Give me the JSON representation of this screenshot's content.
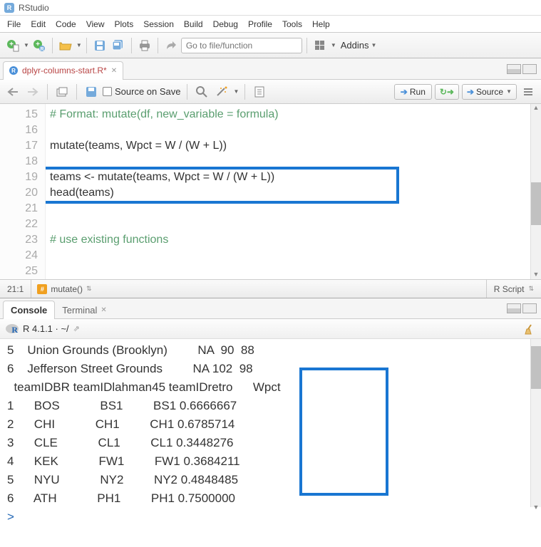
{
  "titlebar": {
    "app_name": "RStudio"
  },
  "menubar": [
    "File",
    "Edit",
    "Code",
    "View",
    "Plots",
    "Session",
    "Build",
    "Debug",
    "Profile",
    "Tools",
    "Help"
  ],
  "toolbar": {
    "goto_placeholder": "Go to file/function",
    "addins_label": "Addins"
  },
  "editor": {
    "tab_name": "dplyr-columns-start.R*",
    "toolbar": {
      "source_on_save": "Source on Save",
      "run": "Run",
      "source": "Source"
    },
    "line_numbers": [
      "15",
      "16",
      "17",
      "18",
      "19",
      "20",
      "21",
      "22",
      "23",
      "24",
      "25"
    ],
    "lines": {
      "l15": "# Format: mutate(df, new_variable = formula)",
      "l16": "",
      "l17": "mutate(teams, Wpct = W / (W + L))",
      "l18": "",
      "l19": "teams <- mutate(teams, Wpct = W / (W + L))",
      "l20": "head(teams)",
      "l21": "",
      "l22": "",
      "l23": "# use existing functions",
      "l24": "",
      "l25": ""
    },
    "status": {
      "cursor": "21:1",
      "scope": "mutate()",
      "lang": "R Script"
    }
  },
  "console": {
    "tabs": {
      "console": "Console",
      "terminal": "Terminal"
    },
    "version": "R 4.1.1 · ~/",
    "output_line1": "5    Union Grounds (Brooklyn)         NA  90  88",
    "output_line2": "6    Jefferson Street Grounds         NA 102  98",
    "output_line3": "  teamIDBR teamIDlahman45 teamIDretro      Wpct",
    "output_line4": "1      BOS            BS1         BS1 0.6666667",
    "output_line5": "2      CHI            CH1         CH1 0.6785714",
    "output_line6": "3      CLE            CL1         CL1 0.3448276",
    "output_line7": "4      KEK            FW1         FW1 0.3684211",
    "output_line8": "5      NYU            NY2         NY2 0.4848485",
    "output_line9": "6      ATH            PH1         PH1 0.7500000",
    "prompt": "> "
  },
  "chart_data": {
    "type": "table",
    "title": "teams (after mutate Wpct = W / (W + L))",
    "columns": [
      "teamIDBR",
      "teamIDlahman45",
      "teamIDretro",
      "Wpct"
    ],
    "rows": [
      {
        "row": 1,
        "teamIDBR": "BOS",
        "teamIDlahman45": "BS1",
        "teamIDretro": "BS1",
        "Wpct": 0.6666667
      },
      {
        "row": 2,
        "teamIDBR": "CHI",
        "teamIDlahman45": "CH1",
        "teamIDretro": "CH1",
        "Wpct": 0.6785714
      },
      {
        "row": 3,
        "teamIDBR": "CLE",
        "teamIDlahman45": "CL1",
        "teamIDretro": "CL1",
        "Wpct": 0.3448276
      },
      {
        "row": 4,
        "teamIDBR": "KEK",
        "teamIDlahman45": "FW1",
        "teamIDretro": "FW1",
        "Wpct": 0.3684211
      },
      {
        "row": 5,
        "teamIDBR": "NYU",
        "teamIDlahman45": "NY2",
        "teamIDretro": "NY2",
        "Wpct": 0.4848485
      },
      {
        "row": 6,
        "teamIDBR": "ATH",
        "teamIDlahman45": "PH1",
        "teamIDretro": "PH1",
        "Wpct": 0.75
      }
    ]
  }
}
